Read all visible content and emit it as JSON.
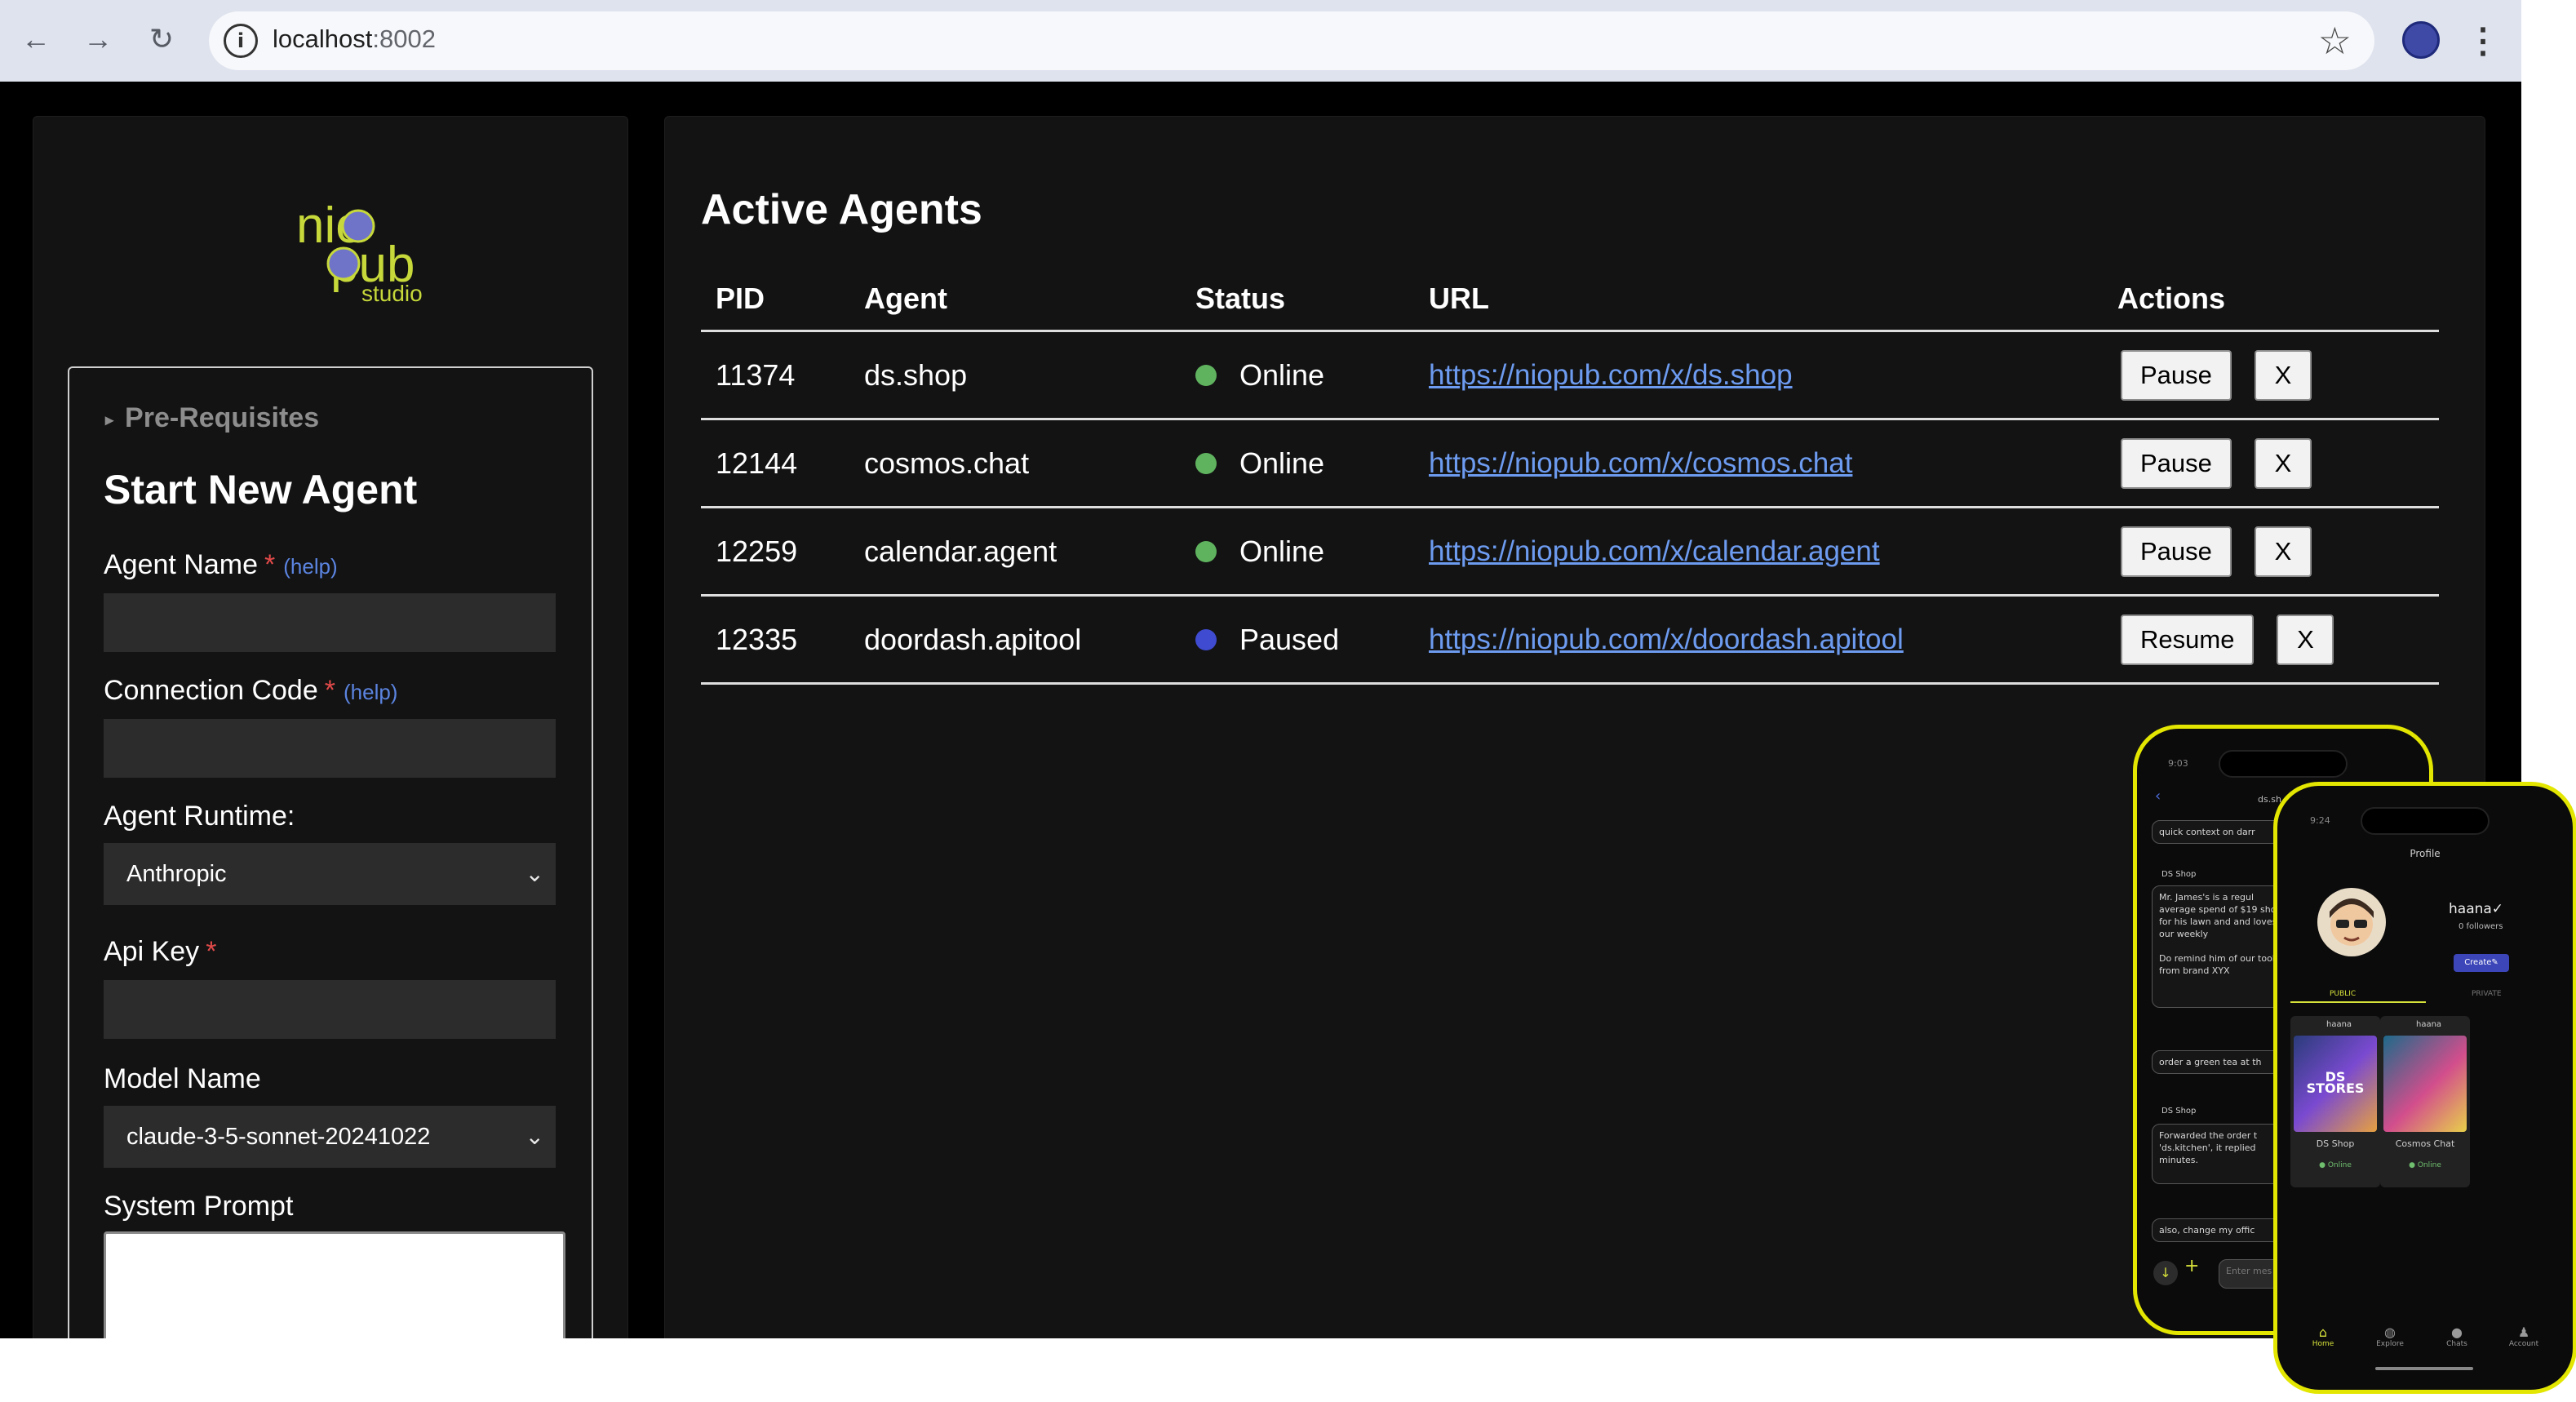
{
  "browser": {
    "url_host": "localhost",
    "url_port": ":8002",
    "nav_back_icon": "←",
    "nav_forward_icon": "→",
    "reload_icon": "↻",
    "site_info_icon": "i",
    "star_icon": "☆",
    "menu_icon": "⋮"
  },
  "logo": {
    "line1": "nio",
    "line2": "pub",
    "subtitle": "studio",
    "accent_color": "#c6d83a",
    "circle_color": "#6f74c9"
  },
  "form": {
    "prerequisites_label": "Pre-Requisites",
    "prerequisites_caret": "▸",
    "title": "Start New Agent",
    "required_mark": "*",
    "help_label": "(help)",
    "agent_name_label": "Agent Name",
    "agent_name_value": "",
    "connection_code_label": "Connection Code",
    "connection_code_value": "",
    "agent_runtime_label": "Agent Runtime:",
    "agent_runtime_value": "Anthropic",
    "api_key_label": "Api Key",
    "api_key_value": "",
    "model_name_label": "Model Name",
    "model_name_value": "claude-3-5-sonnet-20241022",
    "system_prompt_label": "System Prompt",
    "chevron": "⌄"
  },
  "agents": {
    "title": "Active Agents",
    "columns": [
      "PID",
      "Agent",
      "Status",
      "URL",
      "Actions"
    ],
    "rows": [
      {
        "pid": "11374",
        "agent": "ds.shop",
        "status": "Online",
        "status_color": "#5fb35f",
        "url": "https://niopub.com/x/ds.shop",
        "primary_action": "Pause",
        "close_action": "X"
      },
      {
        "pid": "12144",
        "agent": "cosmos.chat",
        "status": "Online",
        "status_color": "#5fb35f",
        "url": "https://niopub.com/x/cosmos.chat",
        "primary_action": "Pause",
        "close_action": "X"
      },
      {
        "pid": "12259",
        "agent": "calendar.agent",
        "status": "Online",
        "status_color": "#5fb35f",
        "url": "https://niopub.com/x/calendar.agent",
        "primary_action": "Pause",
        "close_action": "X"
      },
      {
        "pid": "12335",
        "agent": "doordash.apitool",
        "status": "Paused",
        "status_color": "#3f4bd1",
        "url": "https://niopub.com/x/doordash.apitool",
        "primary_action": "Resume",
        "close_action": "X"
      }
    ]
  },
  "phone_chat": {
    "time": "9:03",
    "header": "ds.sh",
    "msg1": "quick context on darr",
    "sender1": "DS Shop",
    "msg2": "Mr. James's is a regul average spend of $19 shop for his lawn and and loves our weekly\n\nDo remind him of our tools from brand XYX",
    "msg3": "order a green tea at th",
    "sender2": "DS Shop",
    "msg4": "Forwarded the order t 'ds.kitchen', it replied minutes.",
    "msg5": "also, change my offic",
    "input_placeholder": "Enter mes"
  },
  "phone_profile": {
    "time": "9:24",
    "title": "Profile",
    "username": "haana✓",
    "followers": "0 followers",
    "create_label": "Create✎",
    "tab_public": "PUBLIC",
    "tab_private": "PRIVATE",
    "card1_user": "haana",
    "card1_name": "DS Shop",
    "card1_status": "● Online",
    "card1_art": "DS STORES",
    "card2_user": "haana",
    "card2_name": "Cosmos Chat",
    "card2_status": "● Online",
    "nav_home": "Home",
    "nav_explore": "Explore",
    "nav_chats": "Chats",
    "nav_account": "Account"
  }
}
